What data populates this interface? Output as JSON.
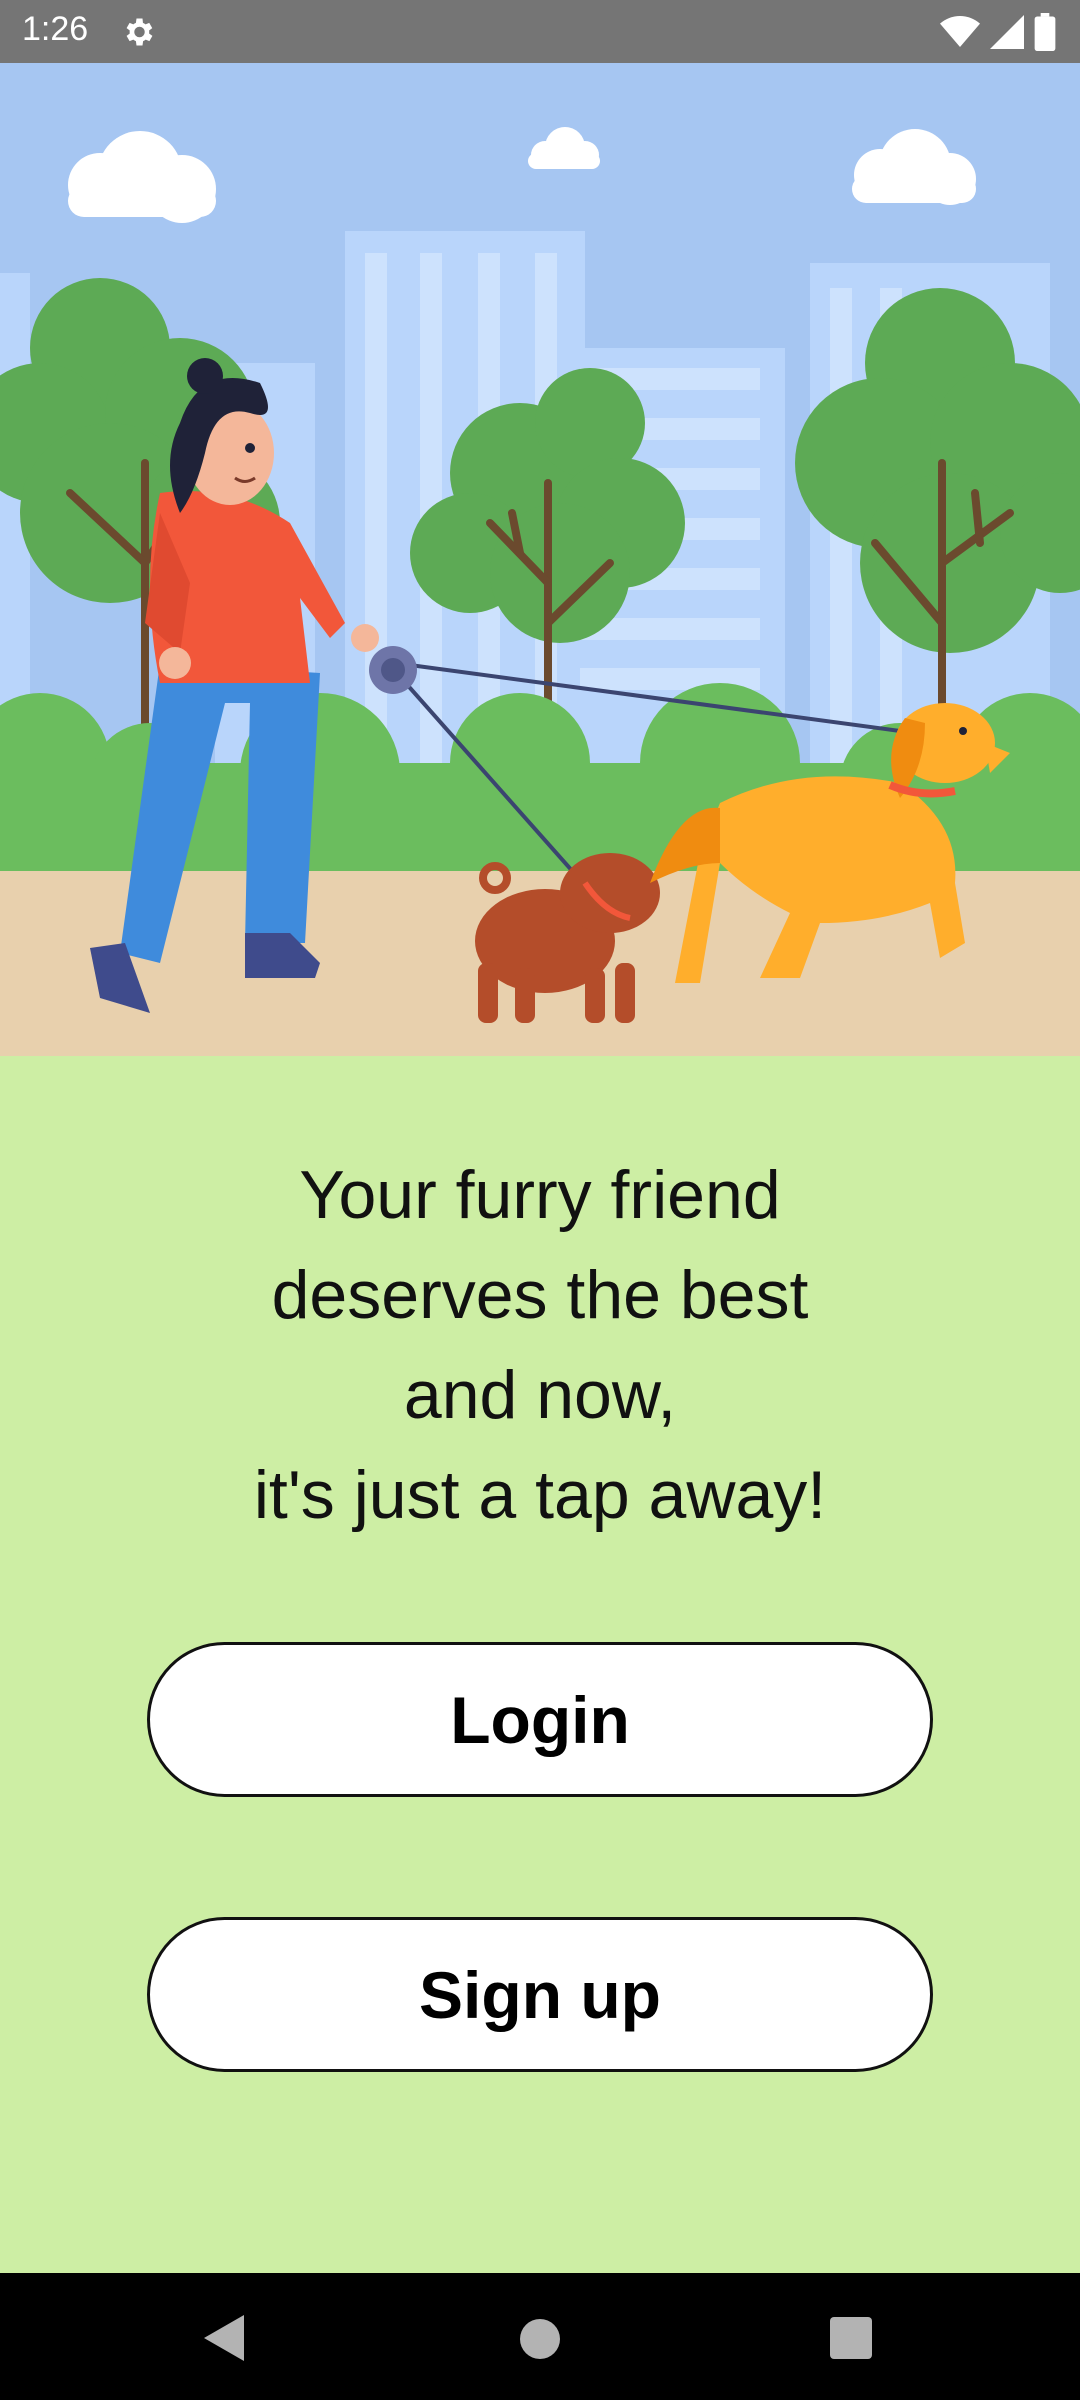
{
  "status_bar": {
    "time": "1:26",
    "icons": [
      "settings-icon",
      "wifi-icon",
      "signal-icon",
      "battery-icon"
    ]
  },
  "hero": {
    "illustration": "woman-walking-two-dogs-in-park"
  },
  "tagline": {
    "line1": "Your furry friend",
    "line2": "deserves the best",
    "line3": "and now,",
    "line4": "it's just a tap away!"
  },
  "buttons": {
    "login_label": "Login",
    "signup_label": "Sign up"
  },
  "nav_bar": {
    "icons": [
      "back-icon",
      "home-icon",
      "recents-icon"
    ]
  },
  "colors": {
    "background": "#cdeea4",
    "sky": "#a6c6f2",
    "grass": "#5daa55",
    "path": "#e8d0ad",
    "button_bg": "#ffffff",
    "button_border": "#111111"
  }
}
